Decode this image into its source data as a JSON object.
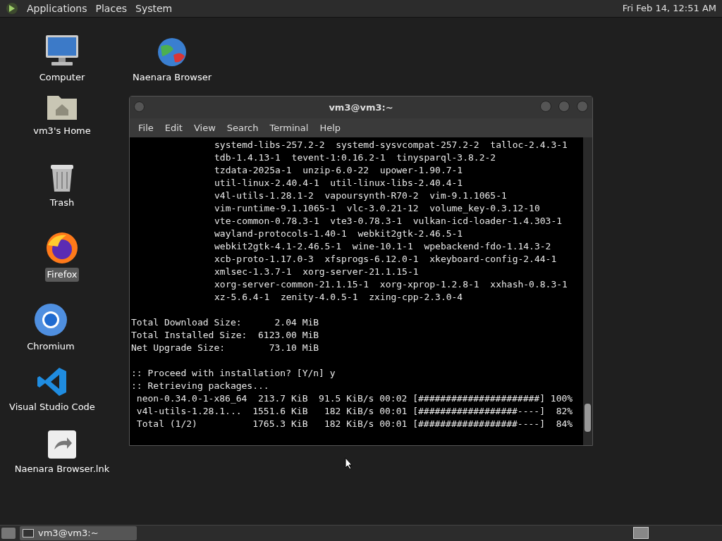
{
  "top_panel": {
    "menus": [
      "Applications",
      "Places",
      "System"
    ],
    "clock": "Fri Feb 14, 12:51 AM"
  },
  "desktop_icons": [
    {
      "label": "Computer",
      "kind": "computer",
      "selected": false
    },
    {
      "label": "Naenara Browser",
      "kind": "globe",
      "selected": false
    },
    {
      "label": "vm3's Home",
      "kind": "home",
      "selected": false
    },
    {
      "label": "Trash",
      "kind": "trash",
      "selected": false
    },
    {
      "label": "Firefox",
      "kind": "firefox",
      "selected": true
    },
    {
      "label": "Chromium",
      "kind": "chromium",
      "selected": false
    },
    {
      "label": "Visual Studio Code",
      "kind": "vscode",
      "selected": false
    },
    {
      "label": "Naenara Browser.lnk",
      "kind": "shortcut",
      "selected": false
    }
  ],
  "terminal": {
    "title": "vm3@vm3:~",
    "menu": [
      "File",
      "Edit",
      "View",
      "Search",
      "Terminal",
      "Help"
    ],
    "lines": [
      {
        "kind": "package",
        "text": "systemd-libs-257.2-2  systemd-sysvcompat-257.2-2  talloc-2.4.3-1"
      },
      {
        "kind": "package",
        "text": "tdb-1.4.13-1  tevent-1:0.16.2-1  tinysparql-3.8.2-2"
      },
      {
        "kind": "package",
        "text": "tzdata-2025a-1  unzip-6.0-22  upower-1.90.7-1"
      },
      {
        "kind": "package",
        "text": "util-linux-2.40.4-1  util-linux-libs-2.40.4-1"
      },
      {
        "kind": "package",
        "text": "v4l-utils-1.28.1-2  vapoursynth-R70-2  vim-9.1.1065-1"
      },
      {
        "kind": "package",
        "text": "vim-runtime-9.1.1065-1  vlc-3.0.21-12  volume_key-0.3.12-10"
      },
      {
        "kind": "package",
        "text": "vte-common-0.78.3-1  vte3-0.78.3-1  vulkan-icd-loader-1.4.303-1"
      },
      {
        "kind": "package",
        "text": "wayland-protocols-1.40-1  webkit2gtk-2.46.5-1"
      },
      {
        "kind": "package",
        "text": "webkit2gtk-4.1-2.46.5-1  wine-10.1-1  wpebackend-fdo-1.14.3-2"
      },
      {
        "kind": "package",
        "text": "xcb-proto-1.17.0-3  xfsprogs-6.12.0-1  xkeyboard-config-2.44-1"
      },
      {
        "kind": "package",
        "text": "xmlsec-1.3.7-1  xorg-server-21.1.15-1"
      },
      {
        "kind": "package",
        "text": "xorg-server-common-21.1.15-1  xorg-xprop-1.2.8-1  xxhash-0.8.3-1"
      },
      {
        "kind": "package",
        "text": "xz-5.6.4-1  zenity-4.0.5-1  zxing-cpp-2.3.0-4"
      },
      {
        "kind": "blank"
      },
      {
        "kind": "plain",
        "text": "Total Download Size:      2.04 MiB"
      },
      {
        "kind": "plain",
        "text": "Total Installed Size:  6123.00 MiB"
      },
      {
        "kind": "plain",
        "text": "Net Upgrade Size:        73.10 MiB"
      },
      {
        "kind": "blank"
      },
      {
        "kind": "plain",
        "text": ":: Proceed with installation? [Y/n] y"
      },
      {
        "kind": "plain",
        "text": ":: Retrieving packages..."
      },
      {
        "kind": "plain",
        "text": " neon-0.34.0-1-x86_64  213.7 KiB  91.5 KiB/s 00:02 [######################] 100%"
      },
      {
        "kind": "plain",
        "text": " v4l-utils-1.28.1...  1551.6 KiB   182 KiB/s 00:01 [##################----]  82%"
      },
      {
        "kind": "plain",
        "text": " Total (1/2)          1765.3 KiB   182 KiB/s 00:01 [##################----]  84%"
      }
    ]
  },
  "taskbar": {
    "tasks": [
      {
        "label": "vm3@vm3:~",
        "selected": false
      }
    ]
  }
}
